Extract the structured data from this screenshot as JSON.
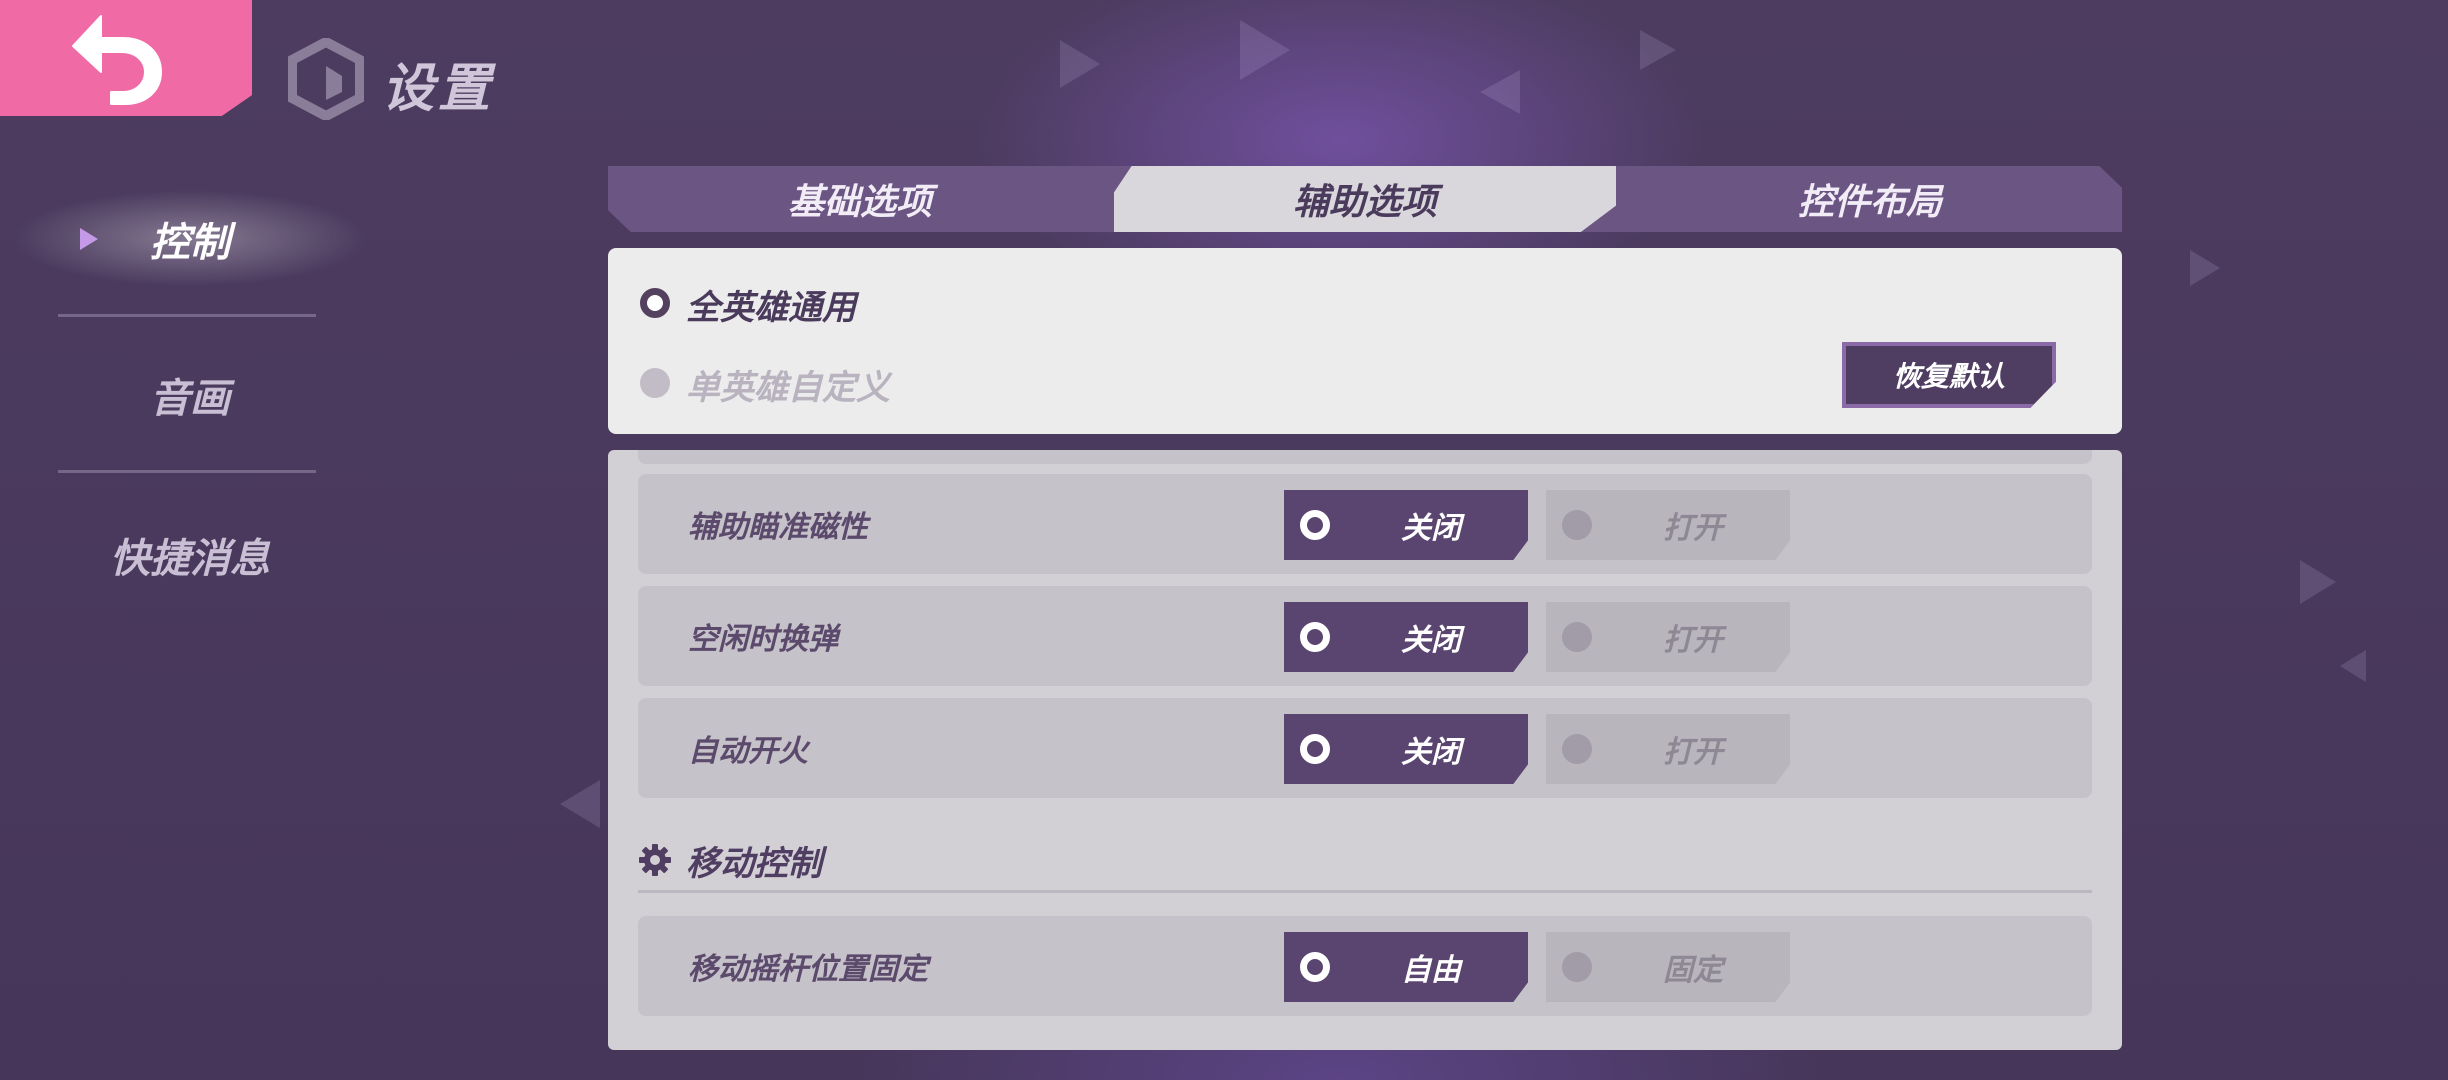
{
  "header": {
    "back_icon": "back-arrow-icon",
    "logo_icon": "game-logo-icon",
    "title": "设置",
    "accent_color": "#f06aa5"
  },
  "sidebar": {
    "items": [
      {
        "label": "控制",
        "active": true
      },
      {
        "label": "音画",
        "active": false
      },
      {
        "label": "快捷消息",
        "active": false
      }
    ]
  },
  "tabs": [
    {
      "label": "基础选项",
      "active": false
    },
    {
      "label": "辅助选项",
      "active": true
    },
    {
      "label": "控件布局",
      "active": false
    }
  ],
  "mode": {
    "options": [
      {
        "label": "全英雄通用",
        "selected": true
      },
      {
        "label": "单英雄自定义",
        "selected": false
      }
    ],
    "restore_label": "恢复默认"
  },
  "settings": [
    {
      "label": "辅助瞄准磁性",
      "options": [
        "关闭",
        "打开"
      ],
      "selected": 0
    },
    {
      "label": "空闲时换弹",
      "options": [
        "关闭",
        "打开"
      ],
      "selected": 0
    },
    {
      "label": "自动开火",
      "options": [
        "关闭",
        "打开"
      ],
      "selected": 0
    }
  ],
  "movement_section": {
    "title": "移动控制",
    "icon": "gear-icon",
    "settings": [
      {
        "label": "移动摇杆位置固定",
        "options": [
          "自由",
          "固定"
        ],
        "selected": 0
      }
    ]
  }
}
